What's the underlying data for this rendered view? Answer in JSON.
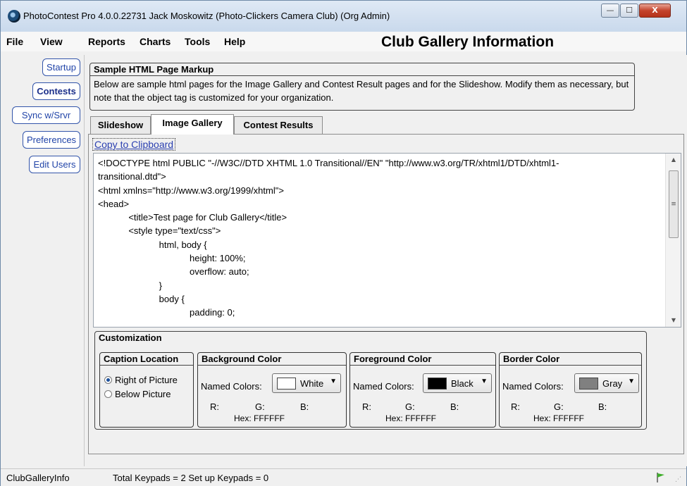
{
  "window": {
    "title": "PhotoContest Pro 4.0.0.22731 Jack Moskowitz (Photo-Clickers Camera Club) (Org Admin)",
    "minimize_glyph": "—",
    "maximize_glyph": "☐",
    "close_glyph": "X"
  },
  "menu": [
    "File",
    "View",
    "Reports",
    "Charts",
    "Tools",
    "Help"
  ],
  "page_heading": "Club Gallery Information",
  "nav": {
    "startup": "Startup",
    "contests": "Contests",
    "sync": "Sync w/Srvr",
    "preferences": "Preferences",
    "edit_users": "Edit Users"
  },
  "markup_box": {
    "title": "Sample HTML Page Markup",
    "description": "Below are sample html pages for the Image Gallery and Contest Result pages and for the Slideshow. Modify them as necessary, but note that the object tag is customized for your organization."
  },
  "tabs": {
    "slideshow": "Slideshow",
    "image_gallery": "Image Gallery",
    "contest_results": "Contest Results",
    "selected": "Image Gallery"
  },
  "copy_link": "Copy to Clipboard",
  "code_lines": [
    "<!DOCTYPE html PUBLIC \"-//W3C//DTD XHTML 1.0 Transitional//EN\" \"http://www.w3.org/TR/xhtml1/DTD/xhtml1-",
    "transitional.dtd\">",
    "<html xmlns=\"http://www.w3.org/1999/xhtml\">",
    "<head>",
    "            <title>Test page for Club Gallery</title>",
    "            <style type=\"text/css\">",
    "                        html, body {",
    "                                    height: 100%;",
    "                                    overflow: auto;",
    "                        }",
    "                        body {",
    "                                    padding: 0;"
  ],
  "customization": {
    "title": "Customization",
    "caption": {
      "title": "Caption Location",
      "options": [
        "Right of Picture",
        "Below Picture"
      ],
      "selected": "Right of Picture"
    },
    "background": {
      "title": "Background Color",
      "named_label": "Named Colors:",
      "value": "White",
      "swatch": "#ffffff",
      "r": "R:",
      "g": "G:",
      "b": "B:",
      "hex": "Hex: FFFFFF"
    },
    "foreground": {
      "title": "Foreground Color",
      "named_label": "Named Colors:",
      "value": "Black",
      "swatch": "#000000",
      "r": "R:",
      "g": "G:",
      "b": "B:",
      "hex": "Hex: FFFFFF"
    },
    "border": {
      "title": "Border Color",
      "named_label": "Named Colors:",
      "value": "Gray",
      "swatch": "#808080",
      "r": "R:",
      "g": "G:",
      "b": "B:",
      "hex": "Hex: FFFFFF"
    }
  },
  "status": {
    "left": "ClubGalleryInfo",
    "keypads": "Total Keypads = 2  Set up Keypads = 0"
  }
}
